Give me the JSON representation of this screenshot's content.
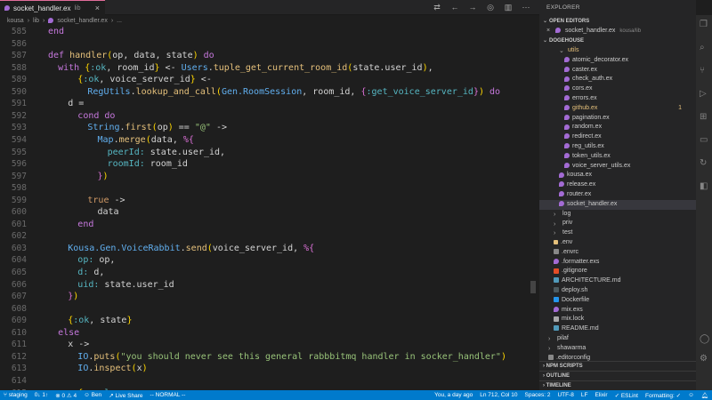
{
  "tab": {
    "filename": "socket_handler.ex",
    "dir": "lib",
    "close": "×"
  },
  "breadcrumb": {
    "parts": [
      "kousa",
      "lib",
      "socket_handler.ex",
      "..."
    ]
  },
  "editor": {
    "lines": [
      {
        "n": "585",
        "indent": 0,
        "html": "<span class='kw'>end</span>"
      },
      {
        "n": "586",
        "indent": 0,
        "html": ""
      },
      {
        "n": "587",
        "indent": 0,
        "html": "<span class='kw'>def</span> <span class='fn'>handler</span><span class='brk1'>(</span>op, data, state<span class='brk1'>)</span> <span class='kw'>do</span>"
      },
      {
        "n": "588",
        "indent": 1,
        "html": "<span class='kw'>with</span> <span class='brk1'>{</span><span class='sym'>:ok</span>, room_id<span class='brk1'>}</span> <- <span class='mod'>Users</span>.<span class='fn'>tuple_get_current_room_id</span><span class='brk1'>(</span>state.user_id<span class='brk1'>)</span>,"
      },
      {
        "n": "589",
        "indent": 3,
        "html": "<span class='brk1'>{</span><span class='sym'>:ok</span>, voice_server_id<span class='brk1'>}</span> <-"
      },
      {
        "n": "590",
        "indent": 4,
        "html": "<span class='mod'>RegUtils</span>.<span class='fn'>lookup_and_call</span><span class='brk1'>(</span><span class='mod'>Gen.RoomSession</span>, room_id, <span class='brk2'>{</span><span class='sym'>:get_voice_server_id</span><span class='brk2'>}</span><span class='brk1'>)</span> <span class='kw'>do</span>"
      },
      {
        "n": "591",
        "indent": 2,
        "html": "d ="
      },
      {
        "n": "592",
        "indent": 3,
        "html": "<span class='kw'>cond do</span>"
      },
      {
        "n": "593",
        "indent": 4,
        "html": "<span class='mod'>String</span>.<span class='fn'>first</span><span class='brk1'>(</span>op<span class='brk1'>)</span> == <span class='str'>\"@\"</span> ->"
      },
      {
        "n": "594",
        "indent": 5,
        "html": "<span class='mod'>Map</span>.<span class='fn'>merge</span><span class='brk1'>(</span>data, <span class='brk2'>%{</span>"
      },
      {
        "n": "595",
        "indent": 6,
        "html": "<span class='sym'>peerId:</span> state.user_id,"
      },
      {
        "n": "596",
        "indent": 6,
        "html": "<span class='sym'>roomId:</span> room_id"
      },
      {
        "n": "597",
        "indent": 5,
        "html": "<span class='brk2'>}</span><span class='brk1'>)</span>"
      },
      {
        "n": "598",
        "indent": 0,
        "html": ""
      },
      {
        "n": "599",
        "indent": 4,
        "html": "<span class='atom'>true</span> ->"
      },
      {
        "n": "600",
        "indent": 5,
        "html": "data"
      },
      {
        "n": "601",
        "indent": 3,
        "html": "<span class='kw'>end</span>"
      },
      {
        "n": "602",
        "indent": 0,
        "html": ""
      },
      {
        "n": "603",
        "indent": 2,
        "html": "<span class='mod'>Kousa.Gen.VoiceRabbit</span>.<span class='fn'>send</span><span class='brk1'>(</span>voice_server_id, <span class='brk2'>%{</span>"
      },
      {
        "n": "604",
        "indent": 3,
        "html": "<span class='sym'>op:</span> op,"
      },
      {
        "n": "605",
        "indent": 3,
        "html": "<span class='sym'>d:</span> d,"
      },
      {
        "n": "606",
        "indent": 3,
        "html": "<span class='sym'>uid:</span> state.user_id"
      },
      {
        "n": "607",
        "indent": 2,
        "html": "<span class='brk2'>}</span><span class='brk1'>)</span>"
      },
      {
        "n": "608",
        "indent": 0,
        "html": ""
      },
      {
        "n": "609",
        "indent": 2,
        "html": "<span class='brk1'>{</span><span class='sym'>:ok</span>, state<span class='brk1'>}</span>"
      },
      {
        "n": "610",
        "indent": 1,
        "html": "<span class='kw'>else</span>"
      },
      {
        "n": "611",
        "indent": 2,
        "html": "x ->"
      },
      {
        "n": "612",
        "indent": 3,
        "html": "<span class='mod'>IO</span>.<span class='fn'>puts</span><span class='brk1'>(</span><span class='str'>\"you should never see this general rabbbitmq handler in socker_handler\"</span><span class='brk1'>)</span>"
      },
      {
        "n": "613",
        "indent": 3,
        "html": "<span class='mod'>IO</span>.<span class='fn'>inspect</span><span class='brk1'>(</span>x<span class='brk1'>)</span>"
      },
      {
        "n": "614",
        "indent": 0,
        "html": ""
      },
      {
        "n": "615",
        "indent": 3,
        "html": "<span class='brk1'>{</span><span class='sym'>:reply</span>,"
      }
    ]
  },
  "explorer": {
    "title": "EXPLORER",
    "open_editors_label": "OPEN EDITORS",
    "open_file": "socket_handler.ex",
    "open_file_dir": "kousa/lib",
    "project_label": "DOGEHOUSE",
    "items": [
      {
        "name": "utils",
        "type": "folder-open",
        "level": 1,
        "modified": true
      },
      {
        "name": "atomic_decorator.ex",
        "type": "elixir",
        "level": 2
      },
      {
        "name": "caster.ex",
        "type": "elixir",
        "level": 2
      },
      {
        "name": "check_auth.ex",
        "type": "elixir",
        "level": 2
      },
      {
        "name": "cors.ex",
        "type": "elixir",
        "level": 2
      },
      {
        "name": "errors.ex",
        "type": "elixir",
        "level": 2
      },
      {
        "name": "github.ex",
        "type": "elixir",
        "level": 2,
        "modified": true,
        "badge": "1"
      },
      {
        "name": "pagination.ex",
        "type": "elixir",
        "level": 2
      },
      {
        "name": "random.ex",
        "type": "elixir",
        "level": 2
      },
      {
        "name": "redirect.ex",
        "type": "elixir",
        "level": 2
      },
      {
        "name": "reg_utils.ex",
        "type": "elixir",
        "level": 2
      },
      {
        "name": "token_utils.ex",
        "type": "elixir",
        "level": 2
      },
      {
        "name": "voice_server_utils.ex",
        "type": "elixir",
        "level": 2
      },
      {
        "name": "kousa.ex",
        "type": "elixir",
        "level": 1
      },
      {
        "name": "release.ex",
        "type": "elixir",
        "level": 1
      },
      {
        "name": "router.ex",
        "type": "elixir",
        "level": 1
      },
      {
        "name": "socket_handler.ex",
        "type": "elixir",
        "level": 1,
        "selected": true
      },
      {
        "name": "log",
        "type": "folder",
        "level": 0
      },
      {
        "name": "priv",
        "type": "folder",
        "level": 0
      },
      {
        "name": "test",
        "type": "folder",
        "level": 0
      },
      {
        "name": ".env",
        "type": "env",
        "level": 0
      },
      {
        "name": ".envrc",
        "type": "fmt",
        "level": 0
      },
      {
        "name": ".formatter.exs",
        "type": "elixir",
        "level": 0
      },
      {
        "name": ".gitignore",
        "type": "git",
        "level": 0
      },
      {
        "name": "ARCHITECTURE.md",
        "type": "md",
        "level": 0
      },
      {
        "name": "deploy.sh",
        "type": "sh",
        "level": 0
      },
      {
        "name": "Dockerfile",
        "type": "docker",
        "level": 0
      },
      {
        "name": "mix.exs",
        "type": "elixir",
        "level": 0
      },
      {
        "name": "mix.lock",
        "type": "lock",
        "level": 0
      },
      {
        "name": "README.md",
        "type": "md",
        "level": 0
      },
      {
        "name": "pilaf",
        "type": "folder",
        "level": -1
      },
      {
        "name": "shawarma",
        "type": "folder",
        "level": -1
      },
      {
        "name": ".editorconfig",
        "type": "fmt",
        "level": -1
      }
    ],
    "npm_scripts": "NPM SCRIPTS",
    "outline": "OUTLINE",
    "timeline": "TIMELINE"
  },
  "statusbar": {
    "branch": "staging",
    "sync": "0↓ 1↑",
    "problems": "⊗ 0 ⚠ 4",
    "user": "Ben",
    "live_share": "Live Share",
    "mode": "-- NORMAL --",
    "blame": "You, a day ago",
    "position": "Ln 712, Col 10",
    "spaces": "Spaces: 2",
    "encoding": "UTF-8",
    "eol": "LF",
    "language": "Elixir",
    "eslint": "✓ ESLint",
    "formatting": "Formatting: ✓"
  }
}
